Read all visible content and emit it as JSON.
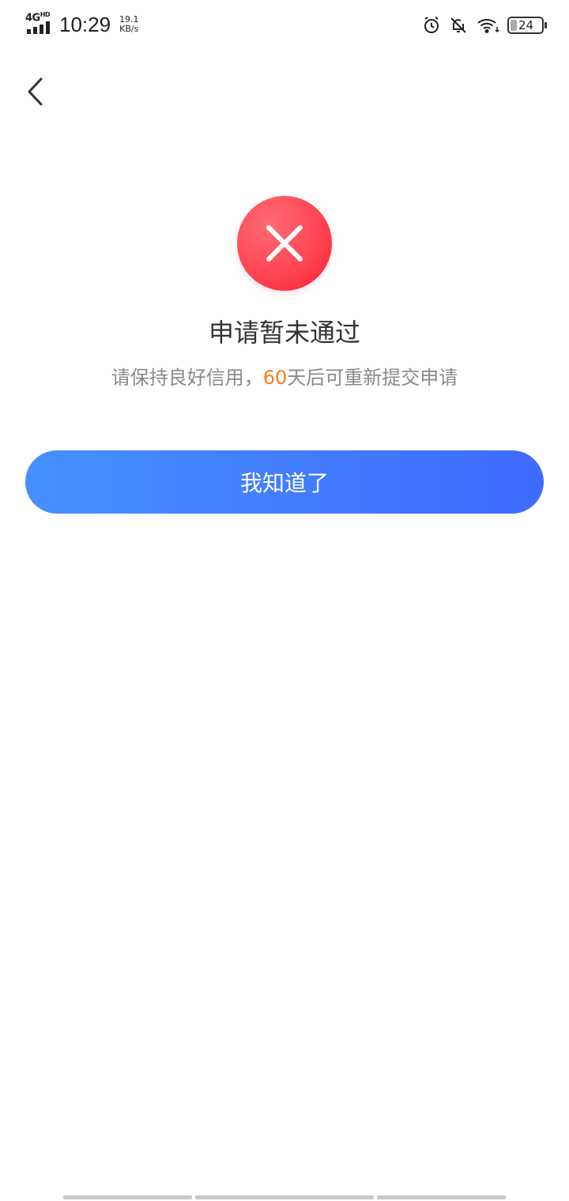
{
  "status_bar": {
    "network": "4G",
    "network_sup": "HD",
    "time": "10:29",
    "speed_value": "19.1",
    "speed_unit": "KB/s",
    "battery": "24",
    "icons": [
      "alarm-icon",
      "bell-off-icon",
      "wifi-icon",
      "battery-icon"
    ]
  },
  "nav": {
    "back_icon": "chevron-left-icon"
  },
  "result": {
    "icon": "close-icon",
    "icon_color": "#ff4653",
    "title": "申请暂未通过",
    "subtitle_prefix": "请保持良好信用，",
    "subtitle_days": "60",
    "subtitle_suffix": "天后可重新提交申请",
    "highlight_color": "#ff7e1c"
  },
  "actions": {
    "confirm_label": "我知道了",
    "button_gradient": [
      "#4690ff",
      "#3f6bff"
    ]
  }
}
